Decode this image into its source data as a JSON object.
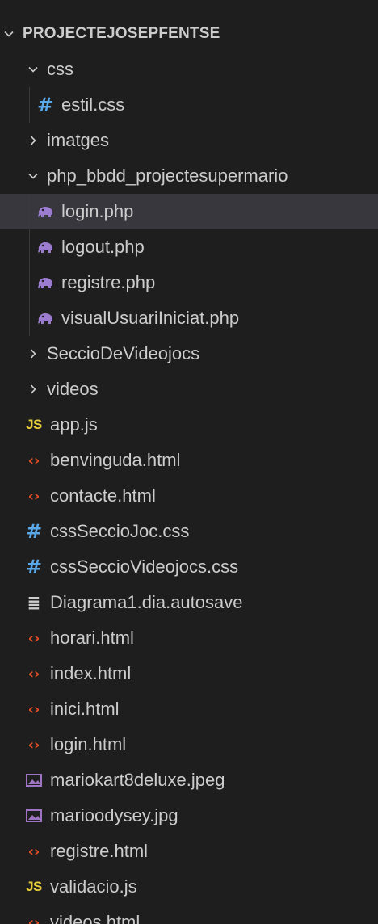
{
  "colors": {
    "background": "#1e1e1e",
    "selected_row": "#37373d",
    "text": "#cccccc",
    "css_icon": "#5aa8e8",
    "js_icon": "#e6cd3c",
    "html_icon": "#e44d26",
    "php_icon": "#9b7ccf",
    "image_icon": "#a074c4"
  },
  "explorer": {
    "root_label": "PROJECTEJOSEPFENTSE",
    "items": [
      {
        "label": "css",
        "type": "folder",
        "expanded": true,
        "depth": 1
      },
      {
        "label": "estil.css",
        "type": "css",
        "depth": 2
      },
      {
        "label": "imatges",
        "type": "folder",
        "expanded": false,
        "depth": 1
      },
      {
        "label": "php_bbdd_projectesupermario",
        "type": "folder",
        "expanded": true,
        "depth": 1
      },
      {
        "label": "login.php",
        "type": "php",
        "depth": 2,
        "selected": true
      },
      {
        "label": "logout.php",
        "type": "php",
        "depth": 2
      },
      {
        "label": "registre.php",
        "type": "php",
        "depth": 2
      },
      {
        "label": "visualUsuariIniciat.php",
        "type": "php",
        "depth": 2
      },
      {
        "label": "SeccioDeVideojocs",
        "type": "folder",
        "expanded": false,
        "depth": 1
      },
      {
        "label": "videos",
        "type": "folder",
        "expanded": false,
        "depth": 1
      },
      {
        "label": "app.js",
        "type": "js",
        "depth": 1
      },
      {
        "label": "benvinguda.html",
        "type": "html",
        "depth": 1
      },
      {
        "label": "contacte.html",
        "type": "html",
        "depth": 1
      },
      {
        "label": "cssSeccioJoc.css",
        "type": "css",
        "depth": 1
      },
      {
        "label": "cssSeccioVideojocs.css",
        "type": "css",
        "depth": 1
      },
      {
        "label": "Diagrama1.dia.autosave",
        "type": "text",
        "depth": 1
      },
      {
        "label": "horari.html",
        "type": "html",
        "depth": 1
      },
      {
        "label": "index.html",
        "type": "html",
        "depth": 1
      },
      {
        "label": "inici.html",
        "type": "html",
        "depth": 1
      },
      {
        "label": "login.html",
        "type": "html",
        "depth": 1
      },
      {
        "label": "mariokart8deluxe.jpeg",
        "type": "image",
        "depth": 1
      },
      {
        "label": "marioodysey.jpg",
        "type": "image",
        "depth": 1
      },
      {
        "label": "registre.html",
        "type": "html",
        "depth": 1
      },
      {
        "label": "validacio.js",
        "type": "js",
        "depth": 1
      },
      {
        "label": "videos.html",
        "type": "html",
        "depth": 1
      }
    ]
  },
  "icons": {
    "chevron_down": "chevron-down-icon",
    "chevron_right": "chevron-right-icon",
    "css": "css-hash-icon",
    "js": "js-file-icon",
    "html": "html-brackets-icon",
    "php": "php-elephant-icon",
    "image": "image-file-icon",
    "text": "text-file-icon"
  }
}
